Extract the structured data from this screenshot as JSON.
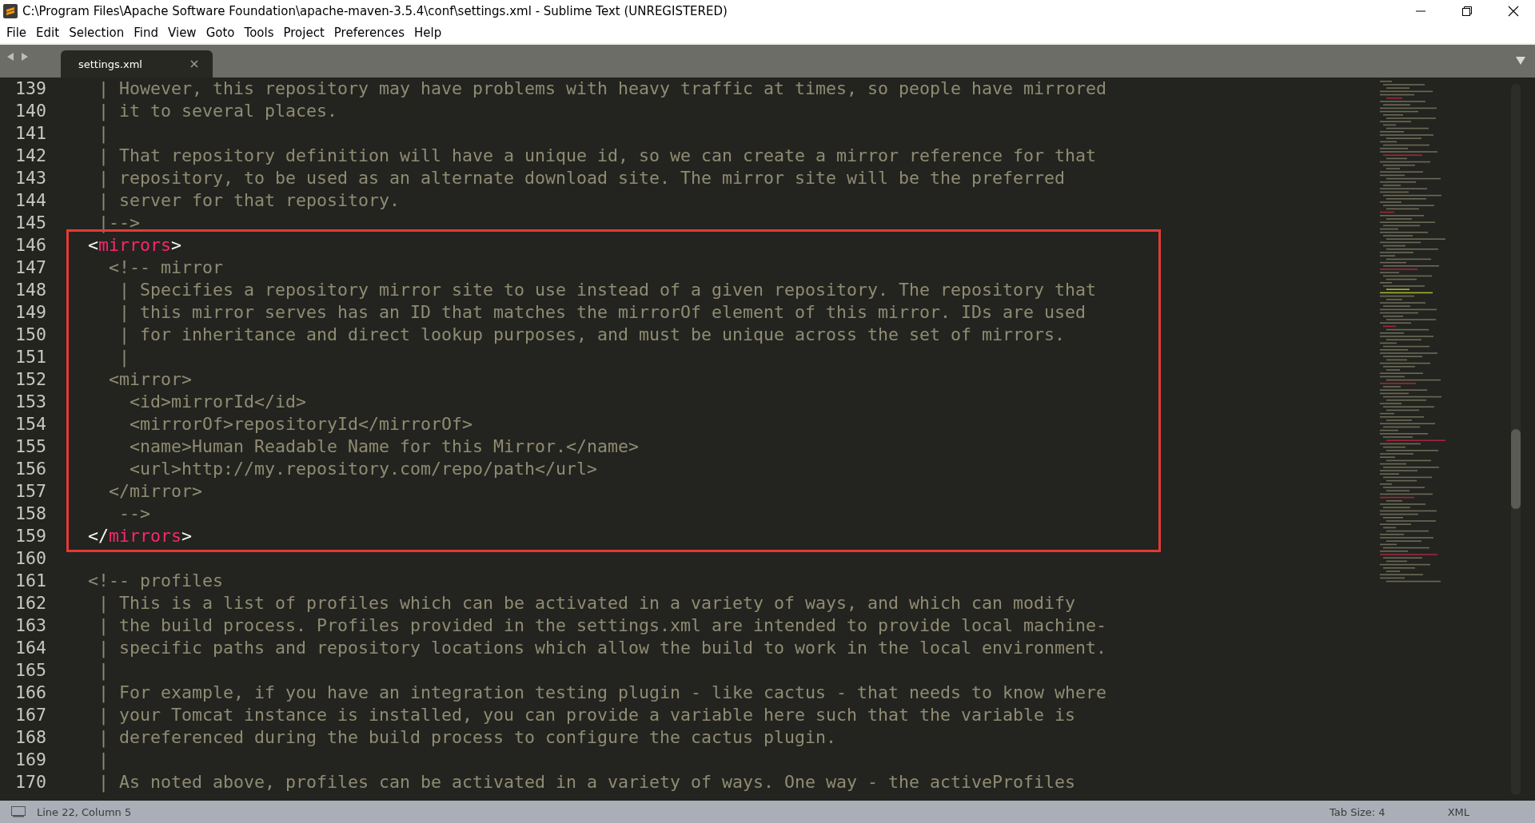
{
  "window": {
    "title": "C:\\Program Files\\Apache Software Foundation\\apache-maven-3.5.4\\conf\\settings.xml - Sublime Text (UNREGISTERED)"
  },
  "menu": [
    "File",
    "Edit",
    "Selection",
    "Find",
    "View",
    "Goto",
    "Tools",
    "Project",
    "Preferences",
    "Help"
  ],
  "tabs": [
    {
      "label": "settings.xml",
      "selected": true
    }
  ],
  "editor": {
    "blocks": [
      {
        "boxed": false,
        "lines": [
          {
            "number": "139",
            "segments": [
              {
                "kind": "comment",
                "text": " | However, this repository may have problems with heavy traffic at times, so people have mirrored"
              }
            ]
          },
          {
            "number": "140",
            "segments": [
              {
                "kind": "comment",
                "text": " | it to several places."
              }
            ]
          },
          {
            "number": "141",
            "segments": [
              {
                "kind": "comment",
                "text": " |"
              }
            ]
          },
          {
            "number": "142",
            "segments": [
              {
                "kind": "comment",
                "text": " | That repository definition will have a unique id, so we can create a mirror reference for that"
              }
            ]
          },
          {
            "number": "143",
            "segments": [
              {
                "kind": "comment",
                "text": " | repository, to be used as an alternate download site. The mirror site will be the preferred"
              }
            ]
          },
          {
            "number": "144",
            "segments": [
              {
                "kind": "comment",
                "text": " | server for that repository."
              }
            ]
          },
          {
            "number": "145",
            "segments": [
              {
                "kind": "comment",
                "text": " |-->"
              }
            ]
          }
        ]
      },
      {
        "boxed": true,
        "lines": [
          {
            "number": "146",
            "segments": [
              {
                "kind": "punct",
                "text": "<"
              },
              {
                "kind": "tag",
                "text": "mirrors"
              },
              {
                "kind": "punct",
                "text": ">"
              }
            ]
          },
          {
            "number": "147",
            "segments": [
              {
                "kind": "comment",
                "text": "  <!-- mirror"
              }
            ]
          },
          {
            "number": "148",
            "segments": [
              {
                "kind": "comment",
                "text": "   | Specifies a repository mirror site to use instead of a given repository. The repository that"
              }
            ]
          },
          {
            "number": "149",
            "segments": [
              {
                "kind": "comment",
                "text": "   | this mirror serves has an ID that matches the mirrorOf element of this mirror. IDs are used"
              }
            ]
          },
          {
            "number": "150",
            "segments": [
              {
                "kind": "comment",
                "text": "   | for inheritance and direct lookup purposes, and must be unique across the set of mirrors."
              }
            ]
          },
          {
            "number": "151",
            "segments": [
              {
                "kind": "comment",
                "text": "   |"
              }
            ]
          },
          {
            "number": "152",
            "segments": [
              {
                "kind": "comment",
                "text": "  <mirror>"
              }
            ]
          },
          {
            "number": "153",
            "segments": [
              {
                "kind": "comment",
                "text": "    <id>mirrorId</id>"
              }
            ]
          },
          {
            "number": "154",
            "segments": [
              {
                "kind": "comment",
                "text": "    <mirrorOf>repositoryId</mirrorOf>"
              }
            ]
          },
          {
            "number": "155",
            "segments": [
              {
                "kind": "comment",
                "text": "    <name>Human Readable Name for this Mirror.</name>"
              }
            ]
          },
          {
            "number": "156",
            "segments": [
              {
                "kind": "comment",
                "text": "    <url>http://my.repository.com/repo/path</url>"
              }
            ]
          },
          {
            "number": "157",
            "segments": [
              {
                "kind": "comment",
                "text": "  </mirror>"
              }
            ]
          },
          {
            "number": "158",
            "segments": [
              {
                "kind": "comment",
                "text": "   -->"
              }
            ]
          },
          {
            "number": "159",
            "segments": [
              {
                "kind": "punct",
                "text": "</"
              },
              {
                "kind": "tag",
                "text": "mirrors"
              },
              {
                "kind": "punct",
                "text": ">"
              }
            ]
          }
        ]
      },
      {
        "boxed": false,
        "lines": [
          {
            "number": "160"
          },
          {
            "number": "161",
            "segments": [
              {
                "kind": "comment",
                "text": "<!-- profiles"
              }
            ]
          },
          {
            "number": "162",
            "segments": [
              {
                "kind": "comment",
                "text": " | This is a list of profiles which can be activated in a variety of ways, and which can modify"
              }
            ]
          },
          {
            "number": "163",
            "segments": [
              {
                "kind": "comment",
                "text": " | the build process. Profiles provided in the settings.xml are intended to provide local machine-"
              }
            ]
          },
          {
            "number": "164",
            "segments": [
              {
                "kind": "comment",
                "text": " | specific paths and repository locations which allow the build to work in the local environment."
              }
            ]
          },
          {
            "number": "165",
            "segments": [
              {
                "kind": "comment",
                "text": " |"
              }
            ]
          },
          {
            "number": "166",
            "segments": [
              {
                "kind": "comment",
                "text": " | For example, if you have an integration testing plugin - like cactus - that needs to know where"
              }
            ]
          },
          {
            "number": "167",
            "segments": [
              {
                "kind": "comment",
                "text": " | your Tomcat instance is installed, you can provide a variable here such that the variable is"
              }
            ]
          },
          {
            "number": "168",
            "segments": [
              {
                "kind": "comment",
                "text": " | dereferenced during the build process to configure the cactus plugin."
              }
            ]
          },
          {
            "number": "169",
            "segments": [
              {
                "kind": "comment",
                "text": " |"
              }
            ]
          },
          {
            "number": "170",
            "segments": [
              {
                "kind": "comment",
                "text": " | As noted above, profiles can be activated in a variety of ways. One way - the activeProfiles"
              }
            ]
          }
        ]
      }
    ]
  },
  "status_bar": {
    "position": "Line 22, Column 5",
    "tab_size": "Tab Size: 4",
    "syntax": "XML"
  }
}
